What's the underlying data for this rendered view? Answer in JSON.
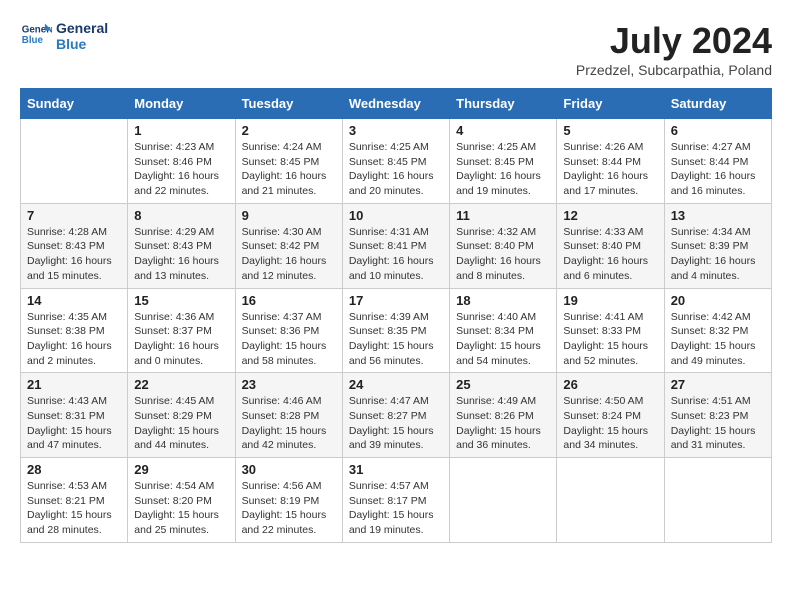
{
  "logo": {
    "line1": "General",
    "line2": "Blue"
  },
  "title": {
    "month_year": "July 2024",
    "location": "Przedzel, Subcarpathia, Poland"
  },
  "days_of_week": [
    "Sunday",
    "Monday",
    "Tuesday",
    "Wednesday",
    "Thursday",
    "Friday",
    "Saturday"
  ],
  "weeks": [
    [
      {
        "day": "",
        "info": ""
      },
      {
        "day": "1",
        "info": "Sunrise: 4:23 AM\nSunset: 8:46 PM\nDaylight: 16 hours\nand 22 minutes."
      },
      {
        "day": "2",
        "info": "Sunrise: 4:24 AM\nSunset: 8:45 PM\nDaylight: 16 hours\nand 21 minutes."
      },
      {
        "day": "3",
        "info": "Sunrise: 4:25 AM\nSunset: 8:45 PM\nDaylight: 16 hours\nand 20 minutes."
      },
      {
        "day": "4",
        "info": "Sunrise: 4:25 AM\nSunset: 8:45 PM\nDaylight: 16 hours\nand 19 minutes."
      },
      {
        "day": "5",
        "info": "Sunrise: 4:26 AM\nSunset: 8:44 PM\nDaylight: 16 hours\nand 17 minutes."
      },
      {
        "day": "6",
        "info": "Sunrise: 4:27 AM\nSunset: 8:44 PM\nDaylight: 16 hours\nand 16 minutes."
      }
    ],
    [
      {
        "day": "7",
        "info": "Sunrise: 4:28 AM\nSunset: 8:43 PM\nDaylight: 16 hours\nand 15 minutes."
      },
      {
        "day": "8",
        "info": "Sunrise: 4:29 AM\nSunset: 8:43 PM\nDaylight: 16 hours\nand 13 minutes."
      },
      {
        "day": "9",
        "info": "Sunrise: 4:30 AM\nSunset: 8:42 PM\nDaylight: 16 hours\nand 12 minutes."
      },
      {
        "day": "10",
        "info": "Sunrise: 4:31 AM\nSunset: 8:41 PM\nDaylight: 16 hours\nand 10 minutes."
      },
      {
        "day": "11",
        "info": "Sunrise: 4:32 AM\nSunset: 8:40 PM\nDaylight: 16 hours\nand 8 minutes."
      },
      {
        "day": "12",
        "info": "Sunrise: 4:33 AM\nSunset: 8:40 PM\nDaylight: 16 hours\nand 6 minutes."
      },
      {
        "day": "13",
        "info": "Sunrise: 4:34 AM\nSunset: 8:39 PM\nDaylight: 16 hours\nand 4 minutes."
      }
    ],
    [
      {
        "day": "14",
        "info": "Sunrise: 4:35 AM\nSunset: 8:38 PM\nDaylight: 16 hours\nand 2 minutes."
      },
      {
        "day": "15",
        "info": "Sunrise: 4:36 AM\nSunset: 8:37 PM\nDaylight: 16 hours\nand 0 minutes."
      },
      {
        "day": "16",
        "info": "Sunrise: 4:37 AM\nSunset: 8:36 PM\nDaylight: 15 hours\nand 58 minutes."
      },
      {
        "day": "17",
        "info": "Sunrise: 4:39 AM\nSunset: 8:35 PM\nDaylight: 15 hours\nand 56 minutes."
      },
      {
        "day": "18",
        "info": "Sunrise: 4:40 AM\nSunset: 8:34 PM\nDaylight: 15 hours\nand 54 minutes."
      },
      {
        "day": "19",
        "info": "Sunrise: 4:41 AM\nSunset: 8:33 PM\nDaylight: 15 hours\nand 52 minutes."
      },
      {
        "day": "20",
        "info": "Sunrise: 4:42 AM\nSunset: 8:32 PM\nDaylight: 15 hours\nand 49 minutes."
      }
    ],
    [
      {
        "day": "21",
        "info": "Sunrise: 4:43 AM\nSunset: 8:31 PM\nDaylight: 15 hours\nand 47 minutes."
      },
      {
        "day": "22",
        "info": "Sunrise: 4:45 AM\nSunset: 8:29 PM\nDaylight: 15 hours\nand 44 minutes."
      },
      {
        "day": "23",
        "info": "Sunrise: 4:46 AM\nSunset: 8:28 PM\nDaylight: 15 hours\nand 42 minutes."
      },
      {
        "day": "24",
        "info": "Sunrise: 4:47 AM\nSunset: 8:27 PM\nDaylight: 15 hours\nand 39 minutes."
      },
      {
        "day": "25",
        "info": "Sunrise: 4:49 AM\nSunset: 8:26 PM\nDaylight: 15 hours\nand 36 minutes."
      },
      {
        "day": "26",
        "info": "Sunrise: 4:50 AM\nSunset: 8:24 PM\nDaylight: 15 hours\nand 34 minutes."
      },
      {
        "day": "27",
        "info": "Sunrise: 4:51 AM\nSunset: 8:23 PM\nDaylight: 15 hours\nand 31 minutes."
      }
    ],
    [
      {
        "day": "28",
        "info": "Sunrise: 4:53 AM\nSunset: 8:21 PM\nDaylight: 15 hours\nand 28 minutes."
      },
      {
        "day": "29",
        "info": "Sunrise: 4:54 AM\nSunset: 8:20 PM\nDaylight: 15 hours\nand 25 minutes."
      },
      {
        "day": "30",
        "info": "Sunrise: 4:56 AM\nSunset: 8:19 PM\nDaylight: 15 hours\nand 22 minutes."
      },
      {
        "day": "31",
        "info": "Sunrise: 4:57 AM\nSunset: 8:17 PM\nDaylight: 15 hours\nand 19 minutes."
      },
      {
        "day": "",
        "info": ""
      },
      {
        "day": "",
        "info": ""
      },
      {
        "day": "",
        "info": ""
      }
    ]
  ]
}
